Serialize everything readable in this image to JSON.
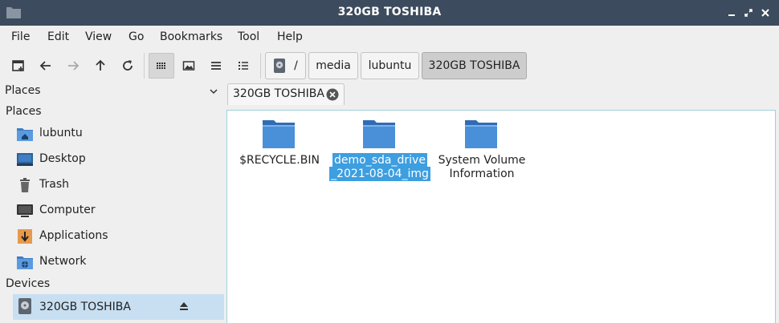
{
  "window": {
    "title": "320GB TOSHIBA"
  },
  "menu": [
    "File",
    "Edit",
    "View",
    "Go",
    "Bookmarks",
    "Tool",
    "Help"
  ],
  "toolbar": {
    "buttons": [
      "new-tab-icon",
      "back-icon",
      "forward-icon",
      "up-icon",
      "reload-icon",
      "icon-view-icon",
      "thumbnail-view-icon",
      "compact-view-icon",
      "detailed-list-view-icon"
    ],
    "breadcrumb": [
      "/",
      "media",
      "lubuntu",
      "320GB TOSHIBA"
    ]
  },
  "sidepane": {
    "header": "Places",
    "sections": {
      "places": "Places",
      "devices": "Devices"
    },
    "places": [
      {
        "label": "lubuntu",
        "icon": "home-folder-icon"
      },
      {
        "label": "Desktop",
        "icon": "desktop-icon"
      },
      {
        "label": "Trash",
        "icon": "trash-icon"
      },
      {
        "label": "Computer",
        "icon": "computer-icon"
      },
      {
        "label": "Applications",
        "icon": "applications-icon"
      },
      {
        "label": "Network",
        "icon": "network-icon"
      }
    ],
    "devices": [
      {
        "label": "320GB TOSHIBA",
        "icon": "drive-icon",
        "selected": true
      }
    ]
  },
  "tabs": [
    {
      "label": "320GB TOSHIBA"
    }
  ],
  "files": [
    {
      "name_line1": "$RECYCLE.BIN",
      "name_line2": "",
      "selected": false
    },
    {
      "name_line1": "demo_sda_drive",
      "name_line2": "_2021-08-04_img",
      "selected": true
    },
    {
      "name_line1": "System Volume",
      "name_line2": "Information",
      "selected": false
    }
  ],
  "colors": {
    "titlebar": "#3c4b5e",
    "selection": "#3d9ee0",
    "sidebar_selection": "#c8dff2",
    "folder": "#4a90d9"
  }
}
